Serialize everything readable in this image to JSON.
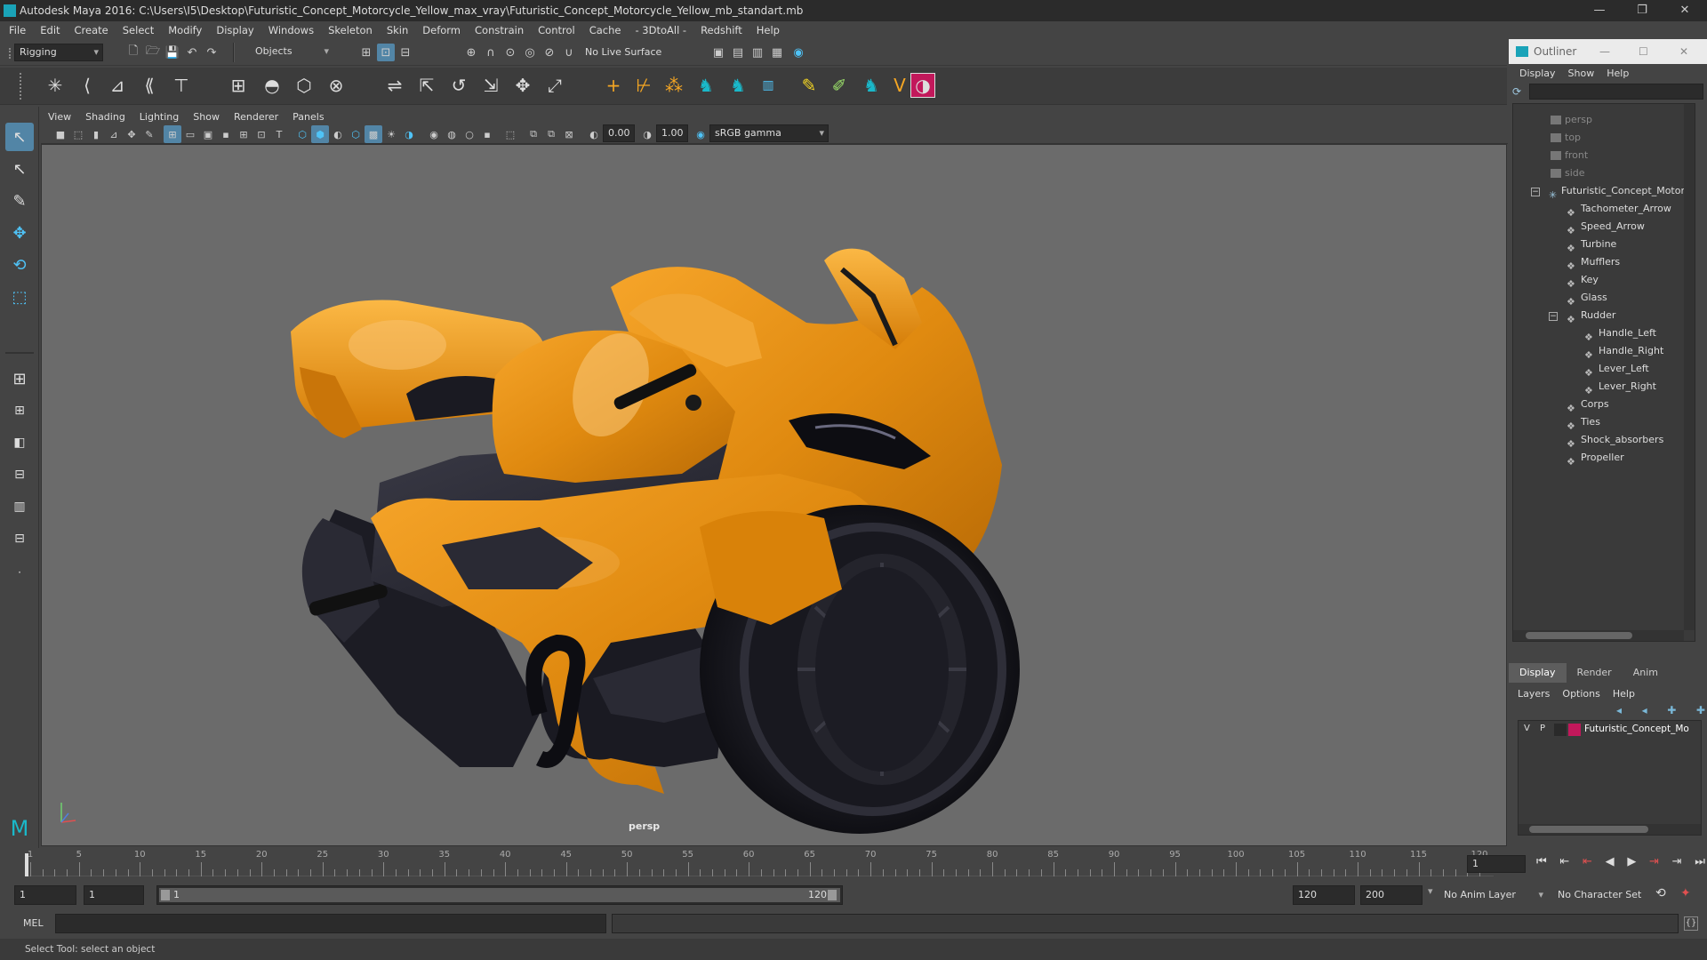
{
  "window": {
    "title": "Autodesk Maya 2016: C:\\Users\\I5\\Desktop\\Futuristic_Concept_Motorcycle_Yellow_max_vray\\Futuristic_Concept_Motorcycle_Yellow_mb_standart.mb",
    "controls": [
      "—",
      "❐",
      "✕"
    ]
  },
  "menubar": [
    "File",
    "Edit",
    "Create",
    "Select",
    "Modify",
    "Display",
    "Windows",
    "Skeleton",
    "Skin",
    "Deform",
    "Constrain",
    "Control",
    "Cache",
    "- 3DtoAll -",
    "Redshift",
    "Help"
  ],
  "toolbar": {
    "mode": "Rigging",
    "selection_mask": "Objects",
    "live_surface": "No Live Surface"
  },
  "panel": {
    "menu": [
      "View",
      "Shading",
      "Lighting",
      "Show",
      "Renderer",
      "Panels"
    ],
    "near_value": "0.00",
    "far_value": "1.00",
    "color_space": "sRGB gamma",
    "camera_label": "persp"
  },
  "outliner": {
    "title": "Outliner",
    "menu": [
      "Display",
      "Show",
      "Help"
    ],
    "items": [
      {
        "label": "persp",
        "dim": true,
        "indent": 0
      },
      {
        "label": "top",
        "dim": true,
        "indent": 0
      },
      {
        "label": "front",
        "dim": true,
        "indent": 0
      },
      {
        "label": "side",
        "dim": true,
        "indent": 0
      },
      {
        "label": "Futuristic_Concept_Motorcy",
        "dim": false,
        "indent": 0
      },
      {
        "label": "Tachometer_Arrow",
        "dim": false,
        "indent": 1
      },
      {
        "label": "Speed_Arrow",
        "dim": false,
        "indent": 1
      },
      {
        "label": "Turbine",
        "dim": false,
        "indent": 1
      },
      {
        "label": "Mufflers",
        "dim": false,
        "indent": 1
      },
      {
        "label": "Key",
        "dim": false,
        "indent": 1
      },
      {
        "label": "Glass",
        "dim": false,
        "indent": 1
      },
      {
        "label": "Rudder",
        "dim": false,
        "indent": 1
      },
      {
        "label": "Handle_Left",
        "dim": false,
        "indent": 2
      },
      {
        "label": "Handle_Right",
        "dim": false,
        "indent": 2
      },
      {
        "label": "Lever_Left",
        "dim": false,
        "indent": 2
      },
      {
        "label": "Lever_Right",
        "dim": false,
        "indent": 2
      },
      {
        "label": "Corps",
        "dim": false,
        "indent": 1
      },
      {
        "label": "Ties",
        "dim": false,
        "indent": 1
      },
      {
        "label": "Shock_absorbers",
        "dim": false,
        "indent": 1
      },
      {
        "label": "Propeller",
        "dim": false,
        "indent": 1
      }
    ]
  },
  "channel_tabs": [
    "Display",
    "Render",
    "Anim"
  ],
  "layer_menu": [
    "Layers",
    "Options",
    "Help"
  ],
  "layer": {
    "v": "V",
    "p": "P",
    "name": "Futuristic_Concept_Mo",
    "color": "#c2185b"
  },
  "timeline": {
    "ticks": [
      1,
      5,
      10,
      15,
      20,
      25,
      30,
      35,
      40,
      45,
      50,
      55,
      60,
      65,
      70,
      75,
      80,
      85,
      90,
      95,
      100,
      105,
      110,
      115,
      120
    ],
    "current_frame": "1"
  },
  "range": {
    "start": "1",
    "playback_start": "1",
    "slider_start": "1",
    "slider_end": "120",
    "playback_end": "120",
    "end": "200",
    "anim_layer": "No Anim Layer",
    "character_set": "No Character Set"
  },
  "cmdline": {
    "lang": "MEL"
  },
  "help_text": "Select Tool: select an object",
  "colors": {
    "accent": "#5285a6",
    "body": "#e8900c",
    "background": "#6b6b6b"
  }
}
